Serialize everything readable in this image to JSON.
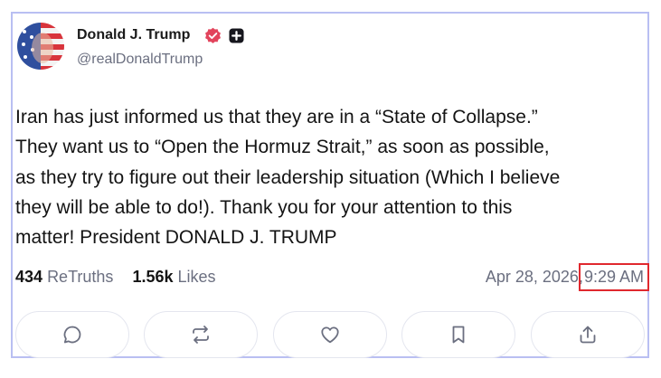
{
  "post": {
    "author": {
      "display_name": "Donald J. Trump",
      "handle": "@realDonaldTrump",
      "verified_icon": "verified-badge-icon",
      "plus_icon": "truth-plus-icon"
    },
    "text": "Iran has just informed us that they are in a “State of Collapse.”\nThey want us to “Open the Hormuz Strait,” as soon as possible,\nas they try to figure out their leadership situation (Which I believe\nthey will be able to do!). Thank you for your attention to this\nmatter! President DONALD J. TRUMP",
    "stats": {
      "retruths_count": "434",
      "retruths_label": "ReTruths",
      "likes_count": "1.56k",
      "likes_label": "Likes"
    },
    "timestamp": {
      "date": "Apr 28, 2026,",
      "time": "9:29 AM"
    },
    "actions": [
      "reply-icon",
      "retruth-icon",
      "like-icon",
      "bookmark-icon",
      "share-icon"
    ]
  },
  "colors": {
    "card_border": "#b9bff2",
    "verified": "#e2445c",
    "highlight": "#e0282e",
    "muted_text": "#6b6f80"
  }
}
